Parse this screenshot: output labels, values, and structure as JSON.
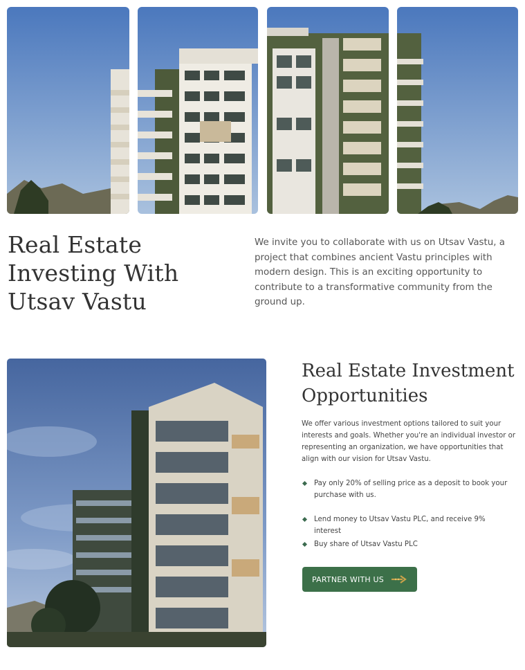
{
  "hero": {
    "images": [
      {
        "name": "building-photo-panel-1"
      },
      {
        "name": "building-photo-panel-2"
      },
      {
        "name": "building-photo-panel-3"
      },
      {
        "name": "building-photo-panel-4"
      }
    ]
  },
  "intro": {
    "title": "Real Estate Investing With Utsav Vastu",
    "body": "We invite you to collaborate with us on Utsav Vastu, a project that combines ancient Vastu principles with modern design. This is an exciting opportunity to contribute to a transformative community from the ground up."
  },
  "opportunities": {
    "title": "Real Estate Investment Opportunities",
    "body": "We offer various investment options tailored to suit your interests and goals. Whether you're an individual investor or representing an organization, we have opportunities that align with our vision for Utsav Vastu.",
    "items": [
      {
        "text": "Pay only 20% of selling price as a deposit to book your purchase with us."
      },
      {
        "text": "Lend money to Utsav Vastu PLC, and receive 9% interest"
      },
      {
        "text": "Buy share of Utsav Vastu PLC"
      }
    ],
    "button_label": "PARTNER WITH US",
    "button_icon": "arrow-right-icon"
  },
  "colors": {
    "accent_green": "#3c7049",
    "bullet_green": "#3b6b4f",
    "button_arrow": "#c9a24a",
    "sky_top": "#4b78bd",
    "sky_bottom": "#a9c1de"
  }
}
